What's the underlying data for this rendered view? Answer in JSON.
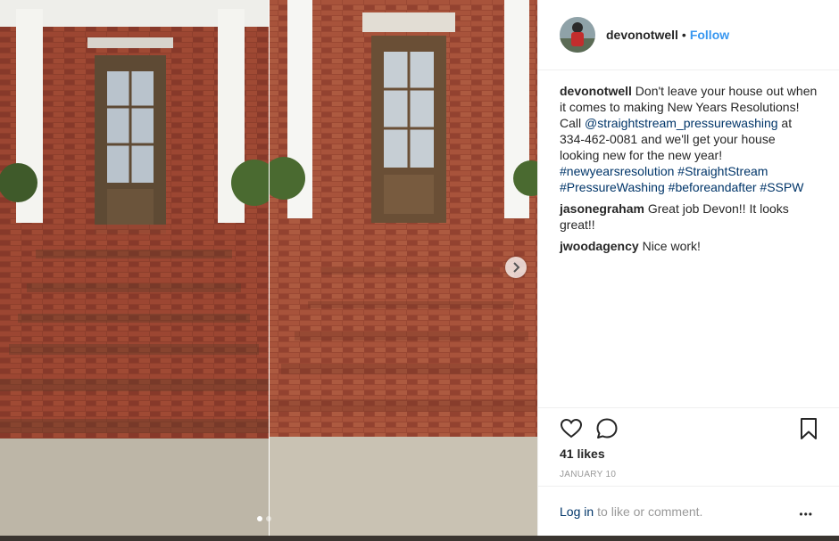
{
  "post": {
    "username": "devonotwell",
    "separator": "•",
    "follow_label": "Follow",
    "caption": {
      "user": "devonotwell",
      "text_1": "Don't leave your house out when it comes to making New Years Resolutions! Call ",
      "mention": "@straightstream_pressurewashing",
      "text_2": " at 334-462-0081 and we'll get your house looking new for the new year! ",
      "tag_1": "#newyearsresolution",
      "tag_2": "#StraightStream",
      "tag_3": "#PressureWashing",
      "tag_4": "#beforeandafter",
      "tag_5": "#SSPW"
    },
    "comments": [
      {
        "user": "jasonegraham",
        "text": "Great job Devon!! It looks great!!"
      },
      {
        "user": "jwoodagency",
        "text": "Nice work!"
      }
    ],
    "likes": "41 likes",
    "date": "JANUARY 10",
    "login_link": "Log in",
    "login_text": "to like or comment.",
    "more_label": "•••"
  },
  "icons": {
    "like": "heart-icon",
    "comment": "comment-bubble-icon",
    "save": "bookmark-icon",
    "next": "chevron-right-icon"
  },
  "colors": {
    "link": "#003569",
    "follow": "#3897f0",
    "text": "#262626",
    "muted": "#999999"
  }
}
